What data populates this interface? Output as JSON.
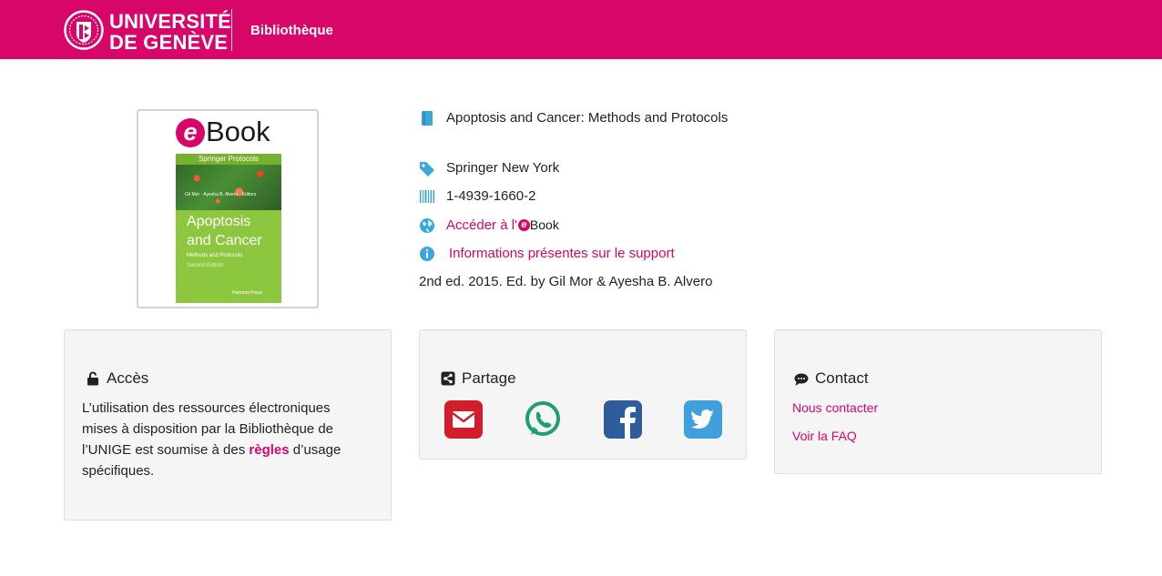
{
  "header": {
    "university_line1": "UNIVERSITÉ",
    "university_line2": "DE GENÈVE",
    "library": "Bibliothèque",
    "brand_color": "#d80669"
  },
  "cover": {
    "ebook_letter": "e",
    "ebook_word": "Book",
    "book_series": "Springer Protocols",
    "book_authors": "Gil Mor · Ayesha B. Alvero · Editors",
    "book_title_line1": "Apoptosis",
    "book_title_line2": "and Cancer",
    "book_subtitle": "Methods and Protocols",
    "book_edition": "Second Edition",
    "book_publisher": "Humana Press"
  },
  "details": {
    "title": "Apoptosis and Cancer: Methods and Protocols",
    "publisher": "Springer New York",
    "isbn": "1-4939-1660-2",
    "access_link": "Accéder à l'",
    "access_ebook_letter": "e",
    "access_ebook_word": "Book",
    "info_link": "Informations présentes sur le support",
    "edition_note": "2nd ed. 2015. Ed. by Gil Mor & Ayesha B. Alvero",
    "icon_color": "#39a8d9"
  },
  "acces_card": {
    "title": "Accès",
    "text_before": "L’utilisation des ressources électroniques mises à disposition par la Bibliothèque de l’UNIGE est soumise à des ",
    "rules_link": "règles",
    "text_after": " d’usage spécifiques."
  },
  "partage_card": {
    "title": "Partage",
    "buttons": [
      {
        "name": "email",
        "color": "#d21e2b"
      },
      {
        "name": "whatsapp",
        "color": "#1e9e74"
      },
      {
        "name": "facebook",
        "color": "#2f5c9b"
      },
      {
        "name": "twitter",
        "color": "#3fa0dc"
      }
    ]
  },
  "contact_card": {
    "title": "Contact",
    "link1": "Nous contacter",
    "link2": "Voir la FAQ"
  }
}
